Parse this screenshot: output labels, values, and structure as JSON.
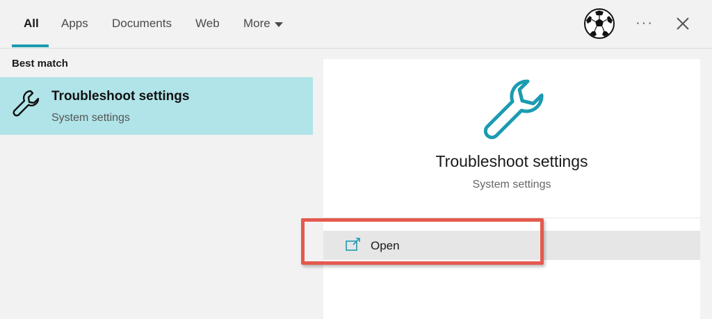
{
  "tabs": [
    {
      "label": "All",
      "active": true
    },
    {
      "label": "Apps"
    },
    {
      "label": "Documents"
    },
    {
      "label": "Web"
    },
    {
      "label": "More"
    }
  ],
  "header": {
    "avatar_icon": "soccer-ball-icon",
    "more_options_label": "···",
    "close_icon": "close-icon"
  },
  "results": {
    "section_label": "Best match",
    "best_match": {
      "title": "Troubleshoot settings",
      "subtitle": "System settings",
      "icon": "wrench-icon"
    }
  },
  "detail": {
    "title": "Troubleshoot settings",
    "subtitle": "System settings",
    "icon": "wrench-icon",
    "actions": [
      {
        "label": "Open",
        "icon": "open-window-icon"
      }
    ]
  },
  "colors": {
    "accent": "#1b9bb1",
    "selection": "#b0e4e8",
    "highlight": "#e45a4e"
  }
}
